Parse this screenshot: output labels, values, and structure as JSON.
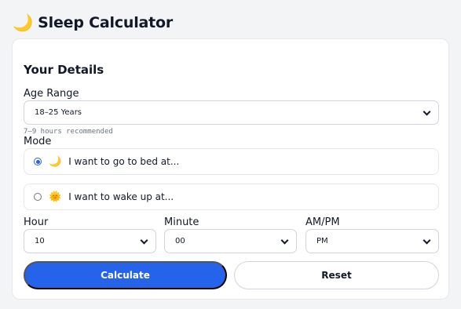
{
  "app": {
    "title": "Sleep Calculator",
    "logo_icon": "moon-icon",
    "logo_glyph": "🌙"
  },
  "details": {
    "title": "Your Details",
    "age_label": "Age Range",
    "age_value": "18–25 Years",
    "age_hint": "7–9 hours recommended",
    "mode_label": "Mode",
    "modes": [
      {
        "label": "I want to go to bed at...",
        "icon": "moon-icon",
        "glyph": "🌙",
        "selected": true
      },
      {
        "label": "I want to wake up at...",
        "icon": "sun-icon",
        "glyph": "🌞",
        "selected": false
      }
    ],
    "hour_label": "Hour",
    "hour_value": "10",
    "minute_label": "Minute",
    "minute_value": "00",
    "ampm_label": "AM/PM",
    "ampm_value": "PM"
  },
  "actions": {
    "calculate_label": "Calculate",
    "reset_label": "Reset"
  },
  "colors": {
    "accent": "#2563eb",
    "background": "#f3f4f6",
    "card": "#ffffff",
    "icon_yellow": "#f4b400"
  }
}
